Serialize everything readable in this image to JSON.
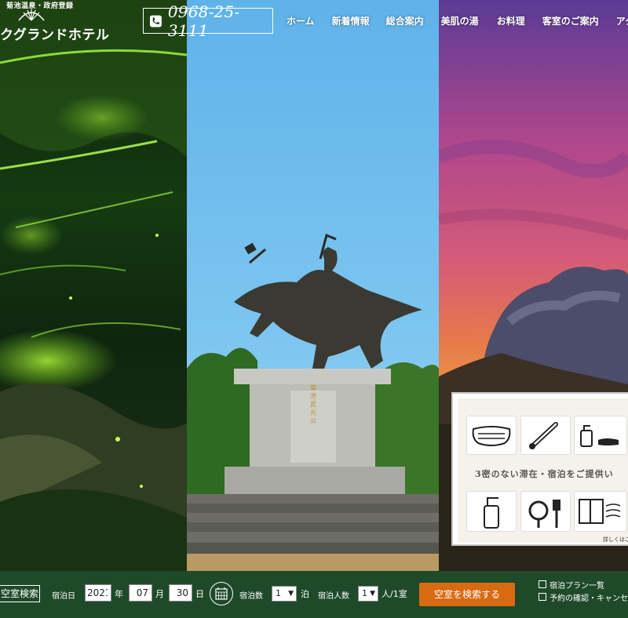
{
  "header": {
    "logo_subtitle": "菊池温泉・政府登録",
    "logo_name": "クグランドホテル",
    "phone": "0968-25-3111",
    "nav": [
      "ホーム",
      "新着情報",
      "総合案内",
      "美肌の湯",
      "お料理",
      "客室のご案内",
      "アク-"
    ]
  },
  "hero": {
    "monument_inscription": "菊 池 武 光 公"
  },
  "notice": {
    "message": "3密のない滞在・宿泊をご提供い",
    "more_link": "詳しくはこち"
  },
  "search_bar": {
    "title": "空室検索",
    "checkin_label": "宿泊日",
    "year": "2021",
    "year_unit": "年",
    "month": "07",
    "month_unit": "月",
    "day": "30",
    "day_unit": "日",
    "nights_label": "宿泊数",
    "nights": "1",
    "nights_unit": "泊",
    "guests_label": "宿泊人数",
    "guests": "1",
    "guests_unit": "人/1室",
    "search_button": "空室を検索する",
    "links": [
      "宿泊プラン一覧",
      "予約の確認・キャンセル"
    ]
  },
  "colors": {
    "bar_bg": "#1f4a2a",
    "search_button": "#d86a12"
  }
}
